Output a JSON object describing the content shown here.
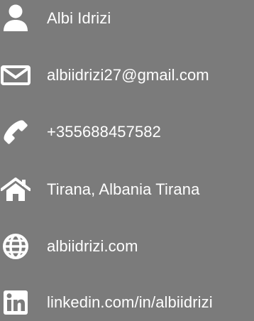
{
  "colors": {
    "background": "#7b7b7b",
    "text": "#ffffff",
    "icon": "#ffffff"
  },
  "contacts": [
    {
      "icon": "user-icon",
      "text": "Albi Idrizi"
    },
    {
      "icon": "envelope-icon",
      "text": "albiidrizi27@gmail.com"
    },
    {
      "icon": "phone-icon",
      "text": "+355688457582"
    },
    {
      "icon": "home-icon",
      "text": "Tirana, Albania Tirana"
    },
    {
      "icon": "globe-icon",
      "text": "albiidrizi.com"
    },
    {
      "icon": "linkedin-icon",
      "text": "linkedin.com/in/albiidrizi"
    }
  ]
}
